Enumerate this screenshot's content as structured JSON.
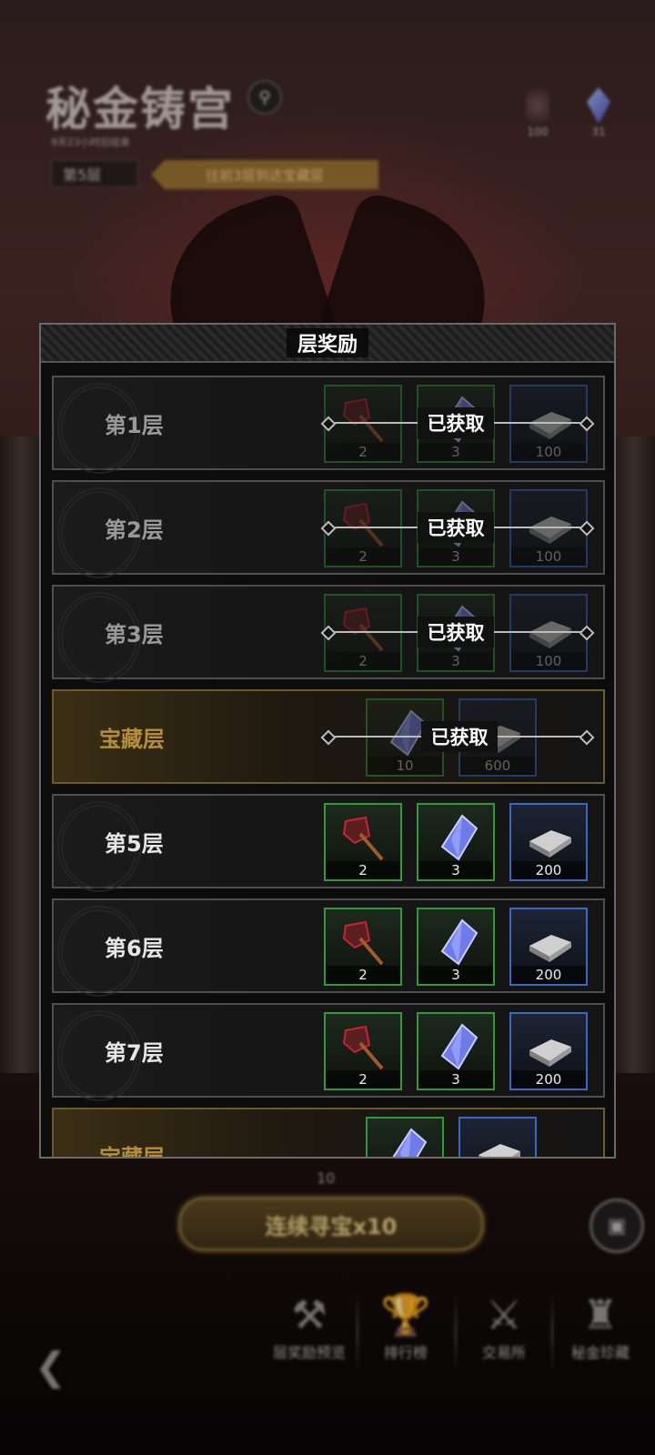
{
  "header": {
    "title": "秘金铸宫",
    "subtitle": "9天23小时后结束",
    "floor": "第5层",
    "hint": "往前3层到达宝藏层",
    "resources": [
      {
        "icon": "anvil-icon",
        "value": "100"
      },
      {
        "icon": "blue-gem-icon",
        "value": "31"
      }
    ]
  },
  "modal": {
    "title": "层奖励",
    "claimed_label": "已获取",
    "rows": [
      {
        "label": "第1层",
        "claimed": true,
        "items": [
          "2",
          "3",
          "100"
        ]
      },
      {
        "label": "第2层",
        "claimed": true,
        "items": [
          "2",
          "3",
          "100"
        ]
      },
      {
        "label": "第3层",
        "claimed": true,
        "items": [
          "2",
          "3",
          "100"
        ]
      },
      {
        "label": "宝藏层",
        "claimed": true,
        "items": [
          "10",
          "600"
        ]
      },
      {
        "label": "第5层",
        "claimed": false,
        "items": [
          "2",
          "3",
          "200"
        ]
      },
      {
        "label": "第6层",
        "claimed": false,
        "items": [
          "2",
          "3",
          "200"
        ]
      },
      {
        "label": "第7层",
        "claimed": false,
        "items": [
          "2",
          "3",
          "200"
        ]
      },
      {
        "label": "宝藏层",
        "claimed": false,
        "items": [
          "",
          ""
        ]
      }
    ]
  },
  "bottom": {
    "cost": "10",
    "seek_button": "连续寻宝x10",
    "nav": [
      {
        "icon": "anvil-icon",
        "label": "层奖励预览"
      },
      {
        "icon": "trophy-icon",
        "label": "排行榜"
      },
      {
        "icon": "hammer-icon",
        "label": "交易所"
      },
      {
        "icon": "helmet-icon",
        "label": "秘金珍藏"
      }
    ]
  }
}
